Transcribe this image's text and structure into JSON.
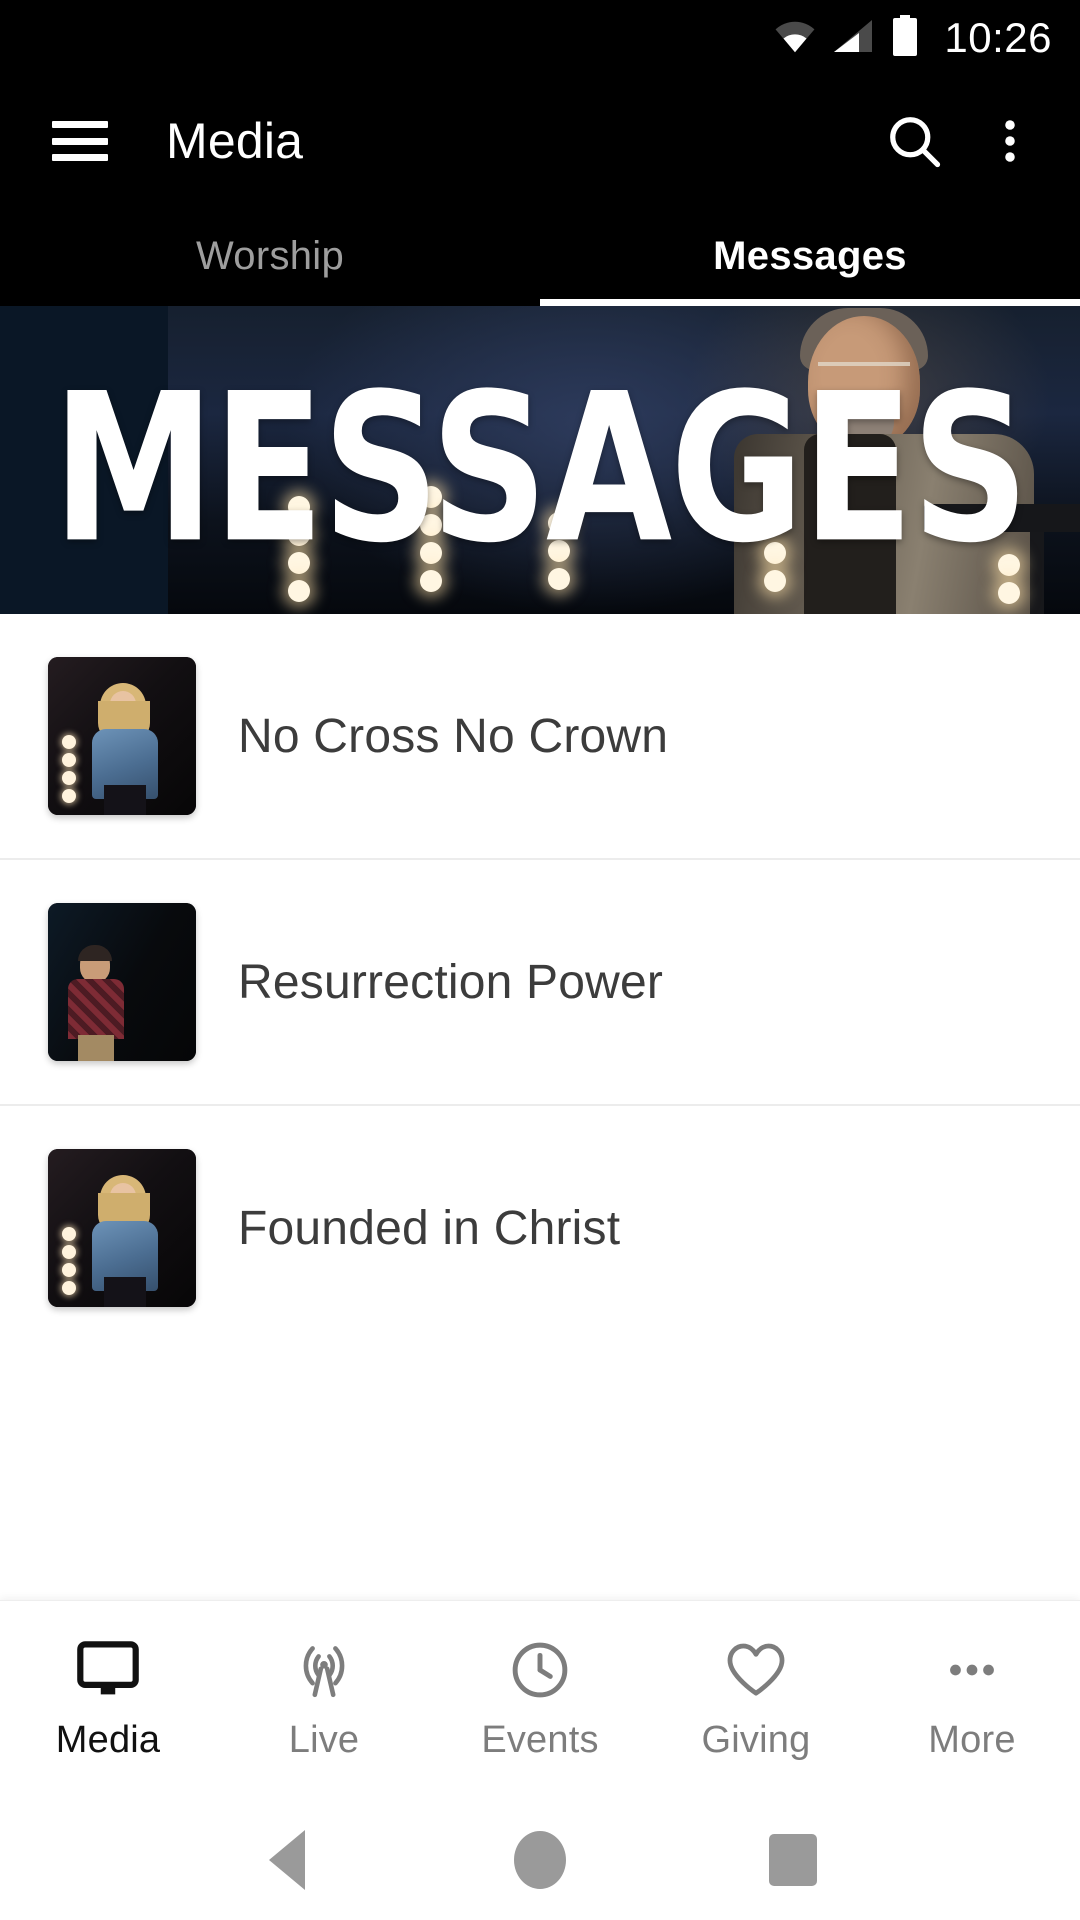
{
  "status_bar": {
    "time": "10:26",
    "icons": [
      "wifi-icon",
      "cellular-signal-icon",
      "battery-icon"
    ]
  },
  "app_bar": {
    "menu_icon": "hamburger-menu-icon",
    "title": "Media",
    "search_icon": "search-icon",
    "overflow_icon": "more-vertical-icon"
  },
  "tabs": [
    {
      "label": "Worship",
      "active": false
    },
    {
      "label": "Messages",
      "active": true
    }
  ],
  "hero": {
    "headline": "MESSAGES",
    "alt": "speaker-at-podium-photo"
  },
  "list": [
    {
      "title": "No Cross No Crown",
      "thumb": "woman-speaking-thumbnail"
    },
    {
      "title": "Resurrection Power",
      "thumb": "man-speaking-thumbnail"
    },
    {
      "title": "Founded in Christ",
      "thumb": "woman-speaking-thumbnail"
    },
    {
      "title": "",
      "thumb": "woman-speaking-thumbnail"
    }
  ],
  "bottom_nav": [
    {
      "label": "Media",
      "icon": "monitor-icon",
      "active": true
    },
    {
      "label": "Live",
      "icon": "broadcast-icon",
      "active": false
    },
    {
      "label": "Events",
      "icon": "clock-icon",
      "active": false
    },
    {
      "label": "Giving",
      "icon": "heart-icon",
      "active": false
    },
    {
      "label": "More",
      "icon": "ellipsis-icon",
      "active": false
    }
  ],
  "system_nav": {
    "back": "back-triangle-icon",
    "home": "home-circle-icon",
    "recents": "recents-square-icon"
  },
  "colors": {
    "app_bar_bg": "#000000",
    "active_tab": "#ffffff",
    "inactive_tab": "#9e9e9e",
    "list_title": "#3c3c3c",
    "nav_active": "#111111",
    "nav_inactive": "#7d7d7d",
    "page_bg": "#ffffff"
  }
}
